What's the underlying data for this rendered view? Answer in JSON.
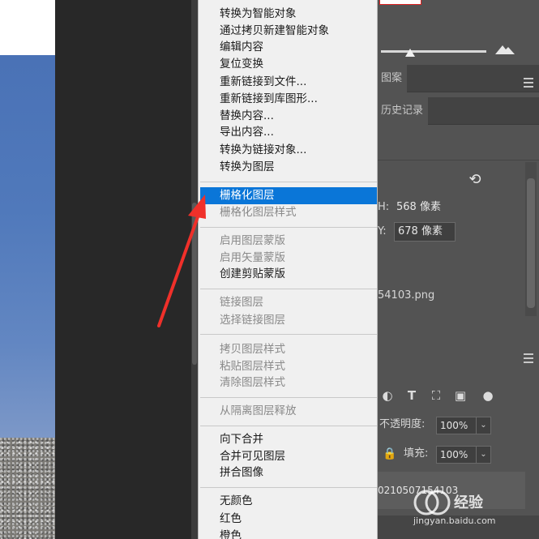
{
  "context_menu": {
    "items": [
      {
        "label": "转换为智能对象",
        "enabled": true
      },
      {
        "label": "通过拷贝新建智能对象",
        "enabled": true
      },
      {
        "label": "编辑内容",
        "enabled": true
      },
      {
        "label": "复位变换",
        "enabled": true
      },
      {
        "label": "重新链接到文件...",
        "enabled": true
      },
      {
        "label": "重新链接到库图形...",
        "enabled": true
      },
      {
        "label": "替换内容...",
        "enabled": true
      },
      {
        "label": "导出内容...",
        "enabled": true
      },
      {
        "label": "转换为链接对象...",
        "enabled": true
      },
      {
        "label": "转换为图层",
        "enabled": true
      },
      {
        "label": "栅格化图层",
        "enabled": true,
        "selected": true
      },
      {
        "label": "栅格化图层样式",
        "enabled": false
      },
      {
        "label": "启用图层蒙版",
        "enabled": false
      },
      {
        "label": "启用矢量蒙版",
        "enabled": false
      },
      {
        "label": "创建剪贴蒙版",
        "enabled": true
      },
      {
        "label": "链接图层",
        "enabled": false
      },
      {
        "label": "选择链接图层",
        "enabled": false
      },
      {
        "label": "拷贝图层样式",
        "enabled": false
      },
      {
        "label": "粘贴图层样式",
        "enabled": false
      },
      {
        "label": "清除图层样式",
        "enabled": false
      },
      {
        "label": "从隔离图层释放",
        "enabled": false
      },
      {
        "label": "向下合并",
        "enabled": true
      },
      {
        "label": "合并可见图层",
        "enabled": true
      },
      {
        "label": "拼合图像",
        "enabled": true
      },
      {
        "label": "无颜色",
        "enabled": true
      },
      {
        "label": "红色",
        "enabled": true
      },
      {
        "label": "橙色",
        "enabled": true
      }
    ]
  },
  "panels": {
    "tab_pattern": "图案",
    "tab_history": "历史记录",
    "properties": {
      "h_label": "H:",
      "h_value": "568 像素",
      "y_label": "Y:",
      "y_value": "678 像素",
      "file_name": "54103.png"
    },
    "layers": {
      "opacity_label": "不透明度:",
      "opacity_value": "100%",
      "fill_label": "填充:",
      "fill_value": "100%",
      "layer_name": "0210507154103"
    }
  },
  "watermark": {
    "brand": "经验",
    "url": "jingyan.baidu.com"
  },
  "colors": {
    "menu_highlight": "#0a76d8",
    "annotation_arrow": "#f0302a",
    "panel_bg": "#535353"
  }
}
